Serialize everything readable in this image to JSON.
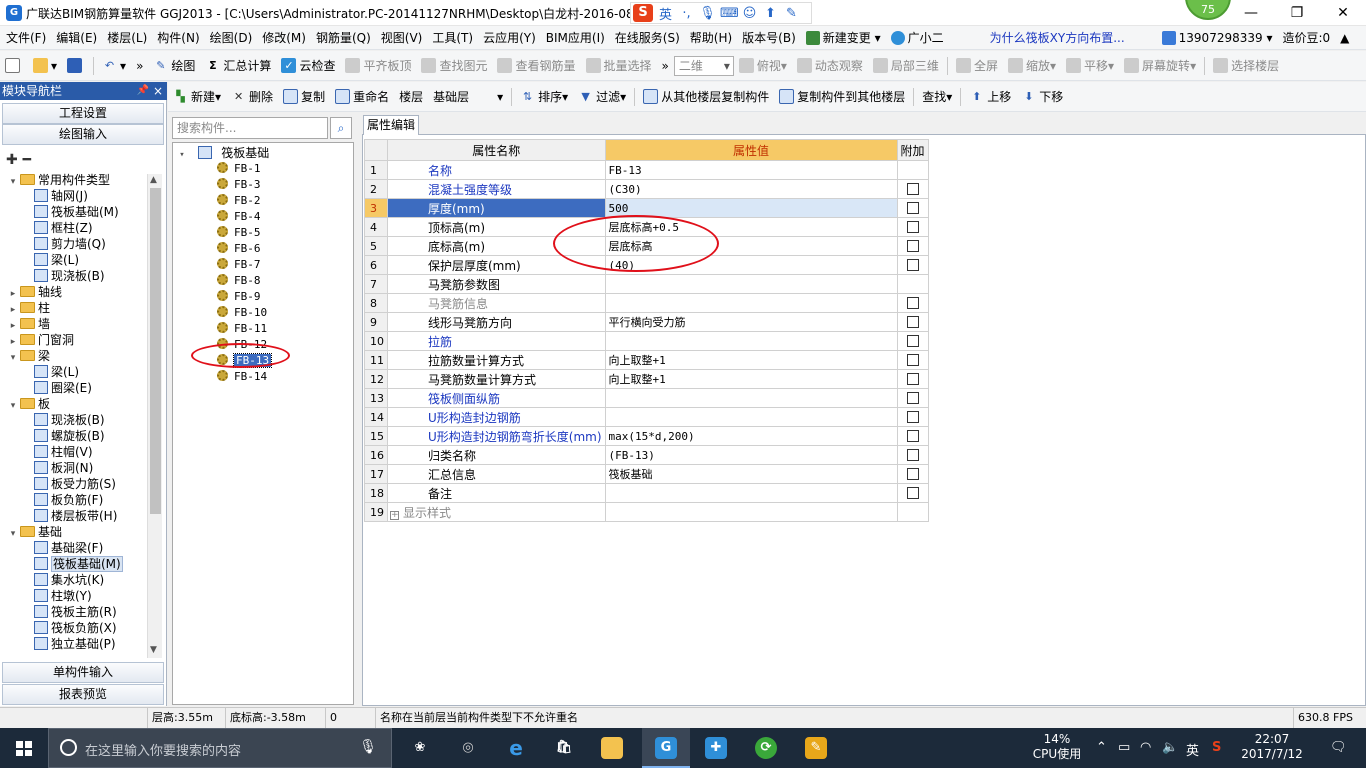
{
  "window": {
    "title": "广联达BIM钢筋算量软件 GGJ2013 - [C:\\Users\\Administrator.PC-20141127NRHM\\Desktop\\白龙村-2016-08-",
    "badge": "75",
    "ime": {
      "logo": "S",
      "lang": "英"
    }
  },
  "menu": {
    "items": [
      "文件(F)",
      "编辑(E)",
      "楼层(L)",
      "构件(N)",
      "绘图(D)",
      "修改(M)",
      "钢筋量(Q)",
      "视图(V)",
      "工具(T)",
      "云应用(Y)",
      "BIM应用(I)",
      "在线服务(S)",
      "帮助(H)",
      "版本号(B)"
    ],
    "new_change": "新建变更",
    "assistant": "广小二",
    "question_link": "为什么筏板XY方向布置...",
    "phone": "13907298339",
    "credits": "造价豆:0"
  },
  "toolbar1": {
    "draw": "绘图",
    "sum_calc": "汇总计算",
    "cloud_check": "云检查",
    "align_top": "平齐板顶",
    "find_elem": "查找图元",
    "view_rebar": "查看钢筋量",
    "batch_select": "批量选择",
    "view_mode": "二维",
    "top_view": "俯视",
    "dynamic_view": "动态观察",
    "local_3d": "局部三维",
    "full_screen": "全屏",
    "zoom": "缩放",
    "pan": "平移",
    "screen_rotate": "屏幕旋转",
    "select_floor": "选择楼层"
  },
  "nav": {
    "header": "模块导航栏",
    "project_settings": "工程设置",
    "draw_input": "绘图输入",
    "single_input": "单构件输入",
    "report_preview": "报表预览",
    "tree": [
      {
        "level": 0,
        "exp": "▾",
        "type": "folder",
        "label": "常用构件类型"
      },
      {
        "level": 1,
        "type": "item",
        "label": "轴网(J)"
      },
      {
        "level": 1,
        "type": "item",
        "label": "筏板基础(M)"
      },
      {
        "level": 1,
        "type": "item",
        "label": "框柱(Z)"
      },
      {
        "level": 1,
        "type": "item",
        "label": "剪力墙(Q)"
      },
      {
        "level": 1,
        "type": "item",
        "label": "梁(L)"
      },
      {
        "level": 1,
        "type": "item",
        "label": "现浇板(B)"
      },
      {
        "level": 0,
        "exp": "▸",
        "type": "folder",
        "label": "轴线"
      },
      {
        "level": 0,
        "exp": "▸",
        "type": "folder",
        "label": "柱"
      },
      {
        "level": 0,
        "exp": "▸",
        "type": "folder",
        "label": "墙"
      },
      {
        "level": 0,
        "exp": "▸",
        "type": "folder",
        "label": "门窗洞"
      },
      {
        "level": 0,
        "exp": "▾",
        "type": "folder",
        "label": "梁"
      },
      {
        "level": 1,
        "type": "item",
        "label": "梁(L)"
      },
      {
        "level": 1,
        "type": "item",
        "label": "圈梁(E)"
      },
      {
        "level": 0,
        "exp": "▾",
        "type": "folder",
        "label": "板"
      },
      {
        "level": 1,
        "type": "item",
        "label": "现浇板(B)"
      },
      {
        "level": 1,
        "type": "item",
        "label": "螺旋板(B)"
      },
      {
        "level": 1,
        "type": "item",
        "label": "柱帽(V)"
      },
      {
        "level": 1,
        "type": "item",
        "label": "板洞(N)"
      },
      {
        "level": 1,
        "type": "item",
        "label": "板受力筋(S)"
      },
      {
        "level": 1,
        "type": "item",
        "label": "板负筋(F)"
      },
      {
        "level": 1,
        "type": "item",
        "label": "楼层板带(H)"
      },
      {
        "level": 0,
        "exp": "▾",
        "type": "folder",
        "label": "基础"
      },
      {
        "level": 1,
        "type": "item",
        "label": "基础梁(F)"
      },
      {
        "level": 1,
        "type": "item",
        "label": "筏板基础(M)",
        "selected": true
      },
      {
        "level": 1,
        "type": "item",
        "label": "集水坑(K)"
      },
      {
        "level": 1,
        "type": "item",
        "label": "柱墩(Y)"
      },
      {
        "level": 1,
        "type": "item",
        "label": "筏板主筋(R)"
      },
      {
        "level": 1,
        "type": "item",
        "label": "筏板负筋(X)"
      },
      {
        "level": 1,
        "type": "item",
        "label": "独立基础(P)"
      }
    ]
  },
  "comp_toolbar": {
    "new": "新建",
    "delete": "删除",
    "copy": "复制",
    "rename": "重命名",
    "floor_label": "楼层",
    "floor_value": "基础层",
    "sort": "排序",
    "filter": "过滤",
    "copy_from": "从其他楼层复制构件",
    "copy_to": "复制构件到其他楼层",
    "find": "查找",
    "move_up": "上移",
    "move_down": "下移"
  },
  "components": {
    "search_placeholder": "搜索构件...",
    "root": "筏板基础",
    "items": [
      "FB-1",
      "FB-3",
      "FB-2",
      "FB-4",
      "FB-5",
      "FB-6",
      "FB-7",
      "FB-8",
      "FB-9",
      "FB-10",
      "FB-11",
      "FB-12",
      "FB-13",
      "FB-14"
    ],
    "selected": "FB-13"
  },
  "props": {
    "tab": "属性编辑",
    "headers": [
      "属性名称",
      "属性值",
      "附加"
    ],
    "rows": [
      {
        "n": "1",
        "name": "名称",
        "value": "FB-13",
        "blue": true,
        "check": false
      },
      {
        "n": "2",
        "name": "混凝土强度等级",
        "value": "(C30)",
        "blue": true,
        "check": true
      },
      {
        "n": "3",
        "name": "厚度(mm)",
        "value": "500",
        "blue": true,
        "check": true,
        "selected": true
      },
      {
        "n": "4",
        "name": "顶标高(m)",
        "value": "层底标高+0.5",
        "check": true
      },
      {
        "n": "5",
        "name": "底标高(m)",
        "value": "层底标高",
        "check": true
      },
      {
        "n": "6",
        "name": "保护层厚度(mm)",
        "value": "(40)",
        "check": true
      },
      {
        "n": "7",
        "name": "马凳筋参数图",
        "value": "",
        "check": false
      },
      {
        "n": "8",
        "name": "马凳筋信息",
        "value": "",
        "gray": true,
        "check": true
      },
      {
        "n": "9",
        "name": "线形马凳筋方向",
        "value": "平行横向受力筋",
        "check": true
      },
      {
        "n": "10",
        "name": "拉筋",
        "value": "",
        "blue": true,
        "check": true
      },
      {
        "n": "11",
        "name": "拉筋数量计算方式",
        "value": "向上取整+1",
        "check": true
      },
      {
        "n": "12",
        "name": "马凳筋数量计算方式",
        "value": "向上取整+1",
        "check": true
      },
      {
        "n": "13",
        "name": "筏板侧面纵筋",
        "value": "",
        "blue": true,
        "check": true
      },
      {
        "n": "14",
        "name": "U形构造封边钢筋",
        "value": "",
        "blue": true,
        "check": true
      },
      {
        "n": "15",
        "name": "U形构造封边钢筋弯折长度(mm)",
        "value": "max(15*d,200)",
        "blue": true,
        "check": true
      },
      {
        "n": "16",
        "name": "归类名称",
        "value": "(FB-13)",
        "check": true
      },
      {
        "n": "17",
        "name": "汇总信息",
        "value": "筏板基础",
        "check": true
      },
      {
        "n": "18",
        "name": "备注",
        "value": "",
        "check": true
      },
      {
        "n": "19",
        "name": "显示样式",
        "value": "",
        "gray": true,
        "expandable": true,
        "check": false
      }
    ]
  },
  "status": {
    "floor_height": "层高:3.55m",
    "bottom_elev": "底标高:-3.58m",
    "zero": "0",
    "message": "名称在当前层当前构件类型下不允许重名",
    "fps": "630.8 FPS"
  },
  "taskbar": {
    "search_placeholder": "在这里输入你要搜索的内容",
    "cpu_value": "14%",
    "cpu_label": "CPU使用",
    "lang": "英",
    "time": "22:07",
    "date": "2017/7/12"
  },
  "colors": {
    "annotation_red": "#e0101a",
    "selection_blue": "#3d6cc0",
    "header_orange": "#f6c966",
    "link_blue": "#1c38c0"
  }
}
